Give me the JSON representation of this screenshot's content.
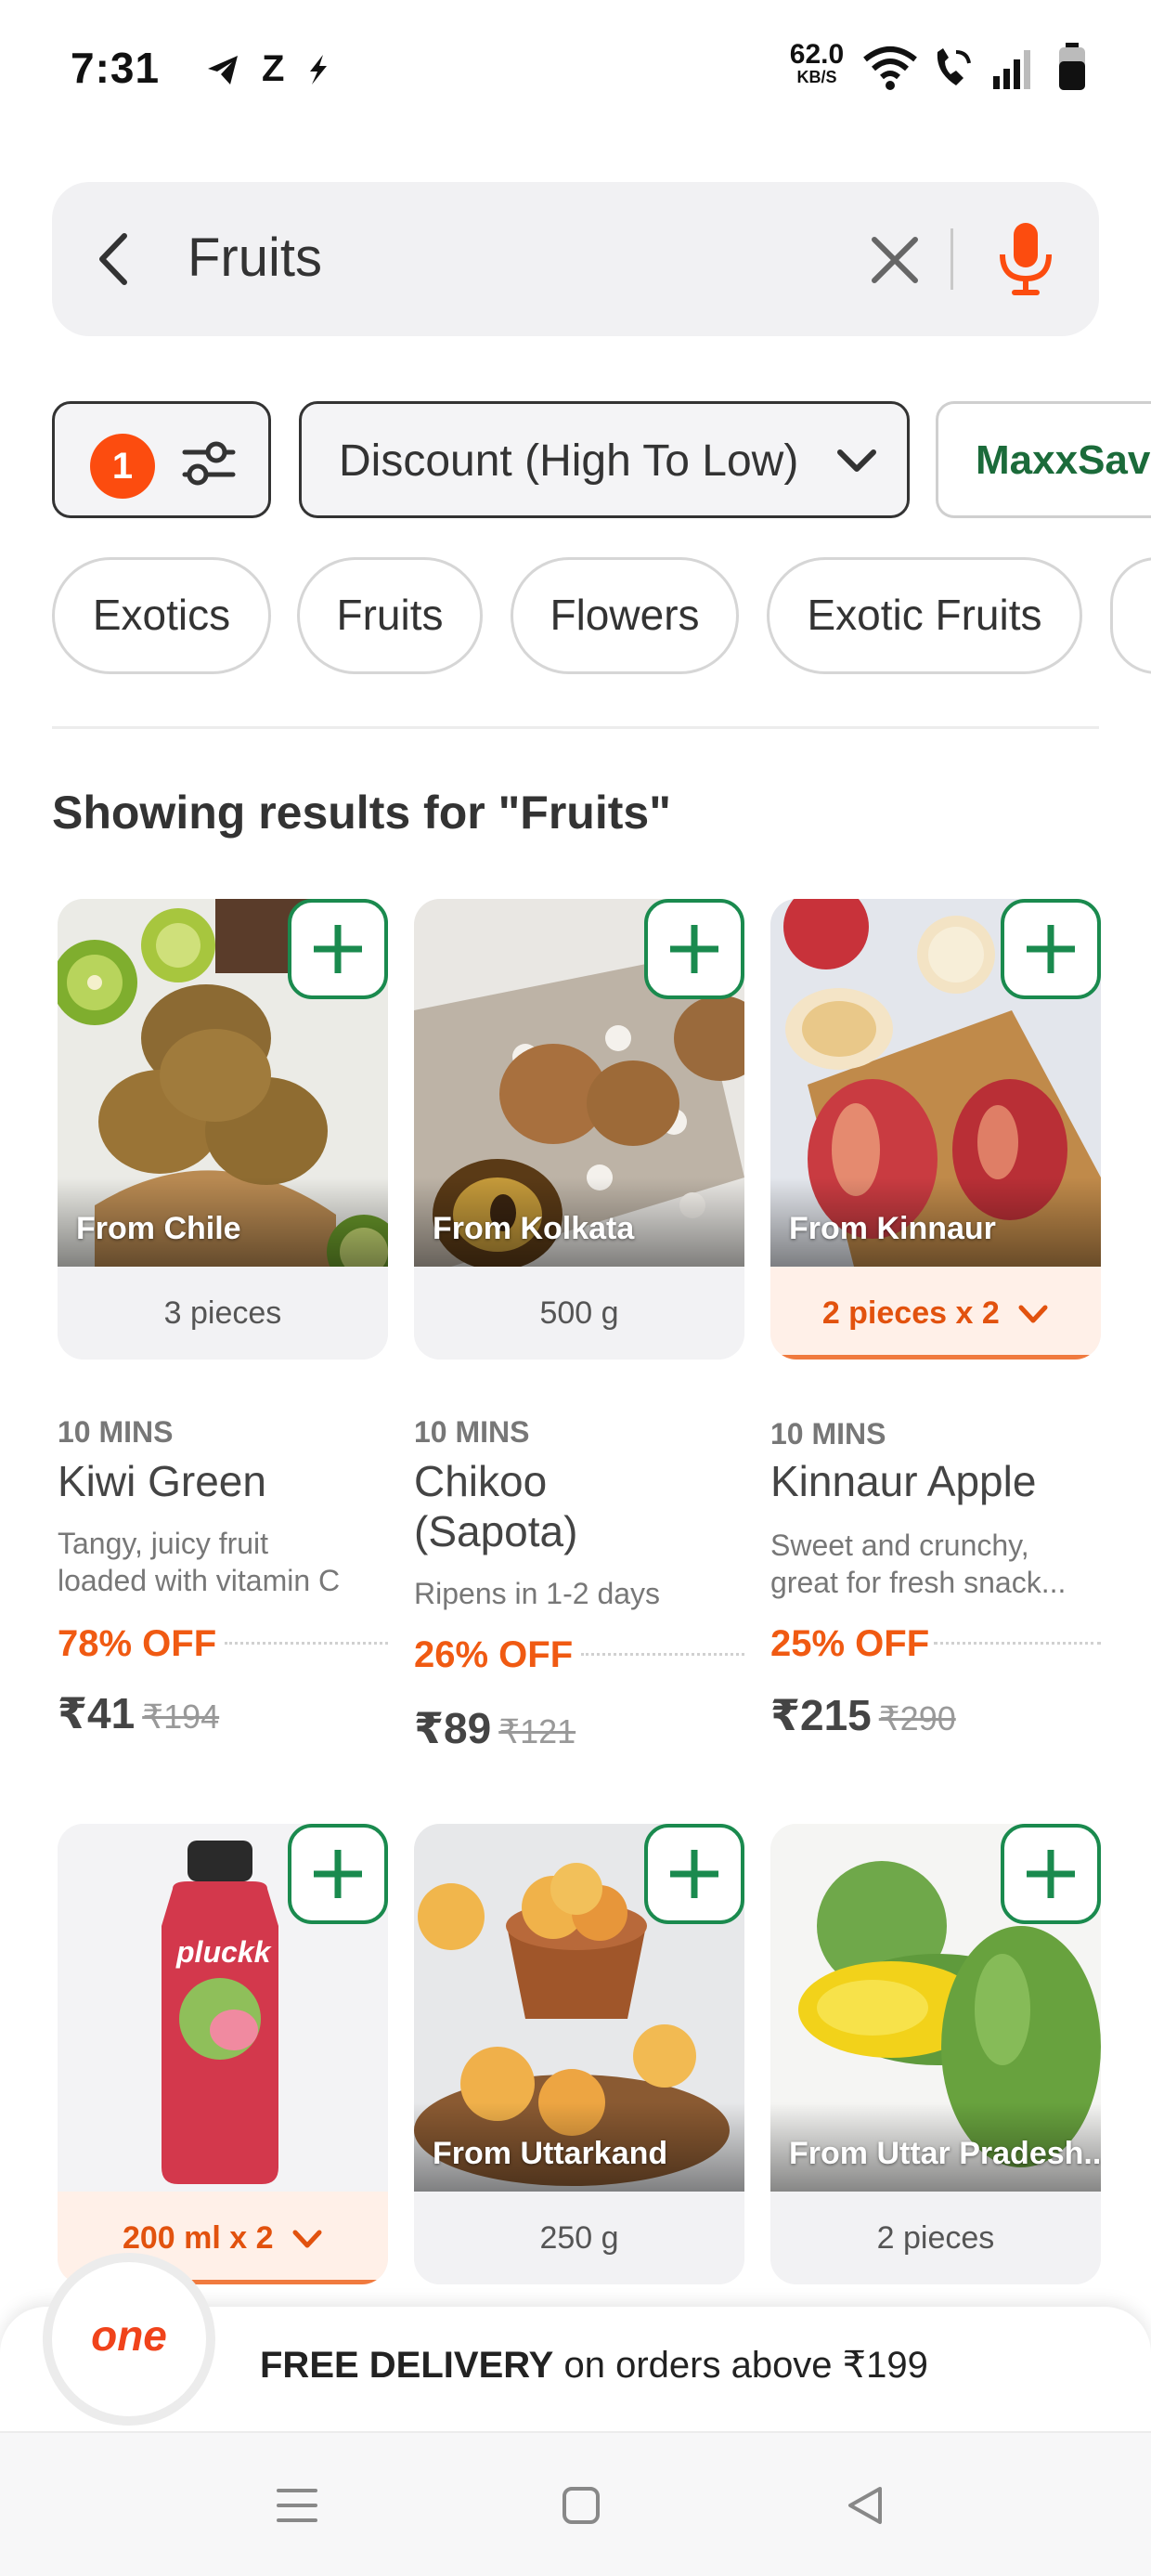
{
  "status_bar": {
    "time": "7:31",
    "carrier_icons": [
      "telegram-icon",
      "z-app-icon",
      "bolt-icon"
    ],
    "net_speed_value": "62.0",
    "net_speed_unit": "KB/S"
  },
  "search": {
    "query": "Fruits"
  },
  "filters": {
    "count": "1",
    "sort_label": "Discount (High To Low)",
    "promo_label": "MaxxSaver"
  },
  "categories": [
    "Exotics",
    "Fruits",
    "Flowers",
    "Exotic Fruits"
  ],
  "results_title": "Showing results for \"Fruits\"",
  "products": [
    {
      "origin": "From Chile",
      "quantity": "3 pieces",
      "eta": "10 MINS",
      "name_line1": "Kiwi Green",
      "name_line2": "",
      "desc_line1": "Tangy, juicy fruit",
      "desc_line2": "loaded with vitamin C",
      "discount": "78% OFF",
      "price": "₹41",
      "mrp": "₹194"
    },
    {
      "origin": "From Kolkata",
      "quantity": "500 g",
      "eta": "10 MINS",
      "name_line1": "Chikoo",
      "name_line2": "(Sapota)",
      "desc_line1": "Ripens in 1-2 days",
      "desc_line2": "",
      "discount": "26% OFF",
      "price": "₹89",
      "mrp": "₹121"
    },
    {
      "origin": "From Kinnaur",
      "quantity": "2 pieces x 2",
      "eta": "10 MINS",
      "name_line1": "Kinnaur Apple",
      "name_line2": "",
      "desc_line1": "Sweet and crunchy,",
      "desc_line2": "great for fresh snack...",
      "discount": "25% OFF",
      "price": "₹215",
      "mrp": "₹290"
    },
    {
      "origin": "",
      "quantity": "200 ml x 2",
      "bottle_brand": "pluckk"
    },
    {
      "origin": "From Uttarkand",
      "quantity": "250 g"
    },
    {
      "origin": "From Uttar Pradesh...",
      "quantity": "2 pieces"
    }
  ],
  "footer": {
    "logo_text": "one",
    "delivery_bold": "FREE DELIVERY",
    "delivery_rest": " on orders above ₹199"
  },
  "colors": {
    "accent_orange": "#fc4c0f",
    "add_green": "#1a8a4e",
    "promo_green": "#1b6b3a"
  }
}
